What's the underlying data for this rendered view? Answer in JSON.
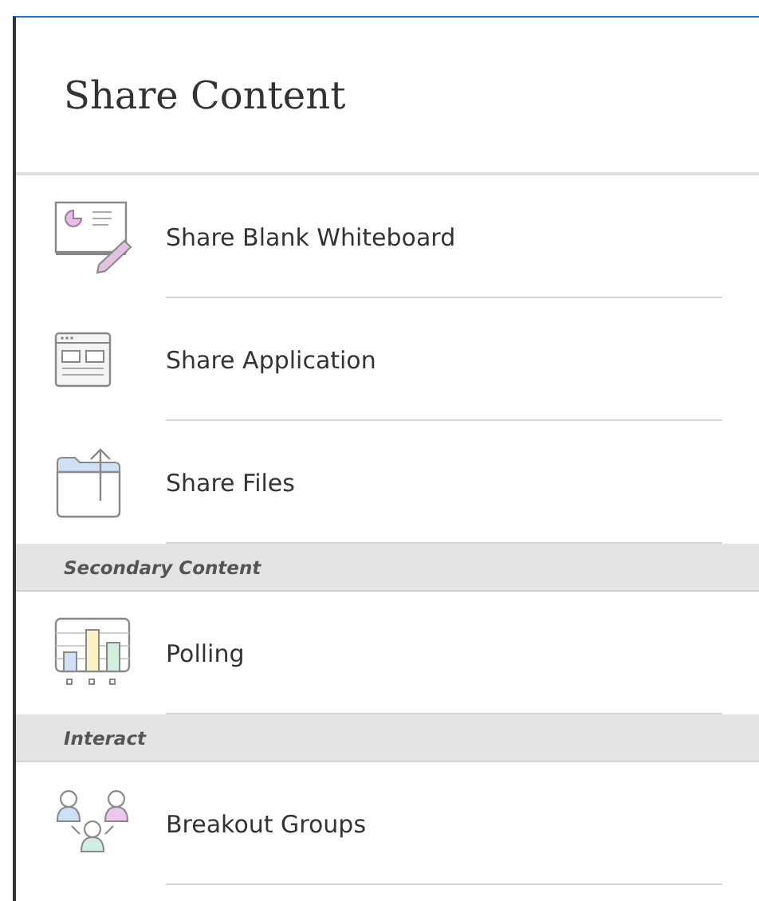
{
  "title": "Share Content",
  "sections": [
    {
      "items": [
        {
          "kind": "whiteboard",
          "label": "Share Blank Whiteboard"
        },
        {
          "kind": "application",
          "label": "Share Application"
        },
        {
          "kind": "files",
          "label": "Share Files"
        }
      ]
    },
    {
      "header": "Secondary Content",
      "items": [
        {
          "kind": "polling",
          "label": "Polling"
        }
      ]
    },
    {
      "header": "Interact",
      "items": [
        {
          "kind": "breakout",
          "label": "Breakout Groups"
        }
      ]
    }
  ]
}
